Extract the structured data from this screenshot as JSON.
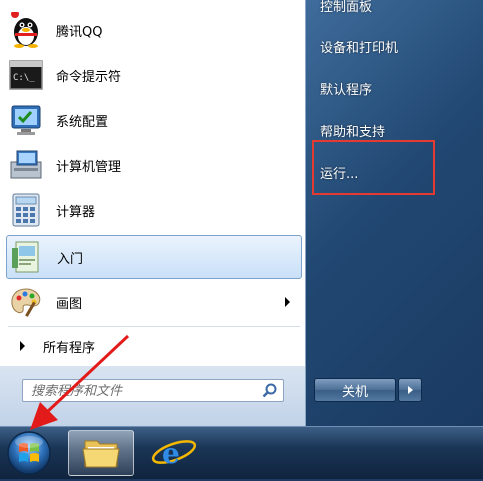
{
  "programs": [
    {
      "label": "腾讯QQ",
      "icon": "qq-penguin-icon"
    },
    {
      "label": "命令提示符",
      "icon": "cmd-prompt-icon"
    },
    {
      "label": "系统配置",
      "icon": "system-config-icon"
    },
    {
      "label": "计算机管理",
      "icon": "computer-management-icon"
    },
    {
      "label": "计算器",
      "icon": "calculator-icon"
    },
    {
      "label": "入门",
      "icon": "getting-started-icon"
    },
    {
      "label": "画图",
      "icon": "paint-palette-icon"
    }
  ],
  "all_programs_label": "所有程序",
  "search": {
    "placeholder": "搜索程序和文件"
  },
  "right_items": [
    {
      "label": "控制面板"
    },
    {
      "label": "设备和打印机"
    },
    {
      "label": "默认程序"
    },
    {
      "label": "帮助和支持"
    },
    {
      "label": "运行..."
    }
  ],
  "shutdown_label": "关机",
  "colors": {
    "highlight_border": "#e53a32",
    "annotation_arrow": "#e21a1a",
    "right_panel": "#214872",
    "selected_item": "#c9e0f7"
  }
}
